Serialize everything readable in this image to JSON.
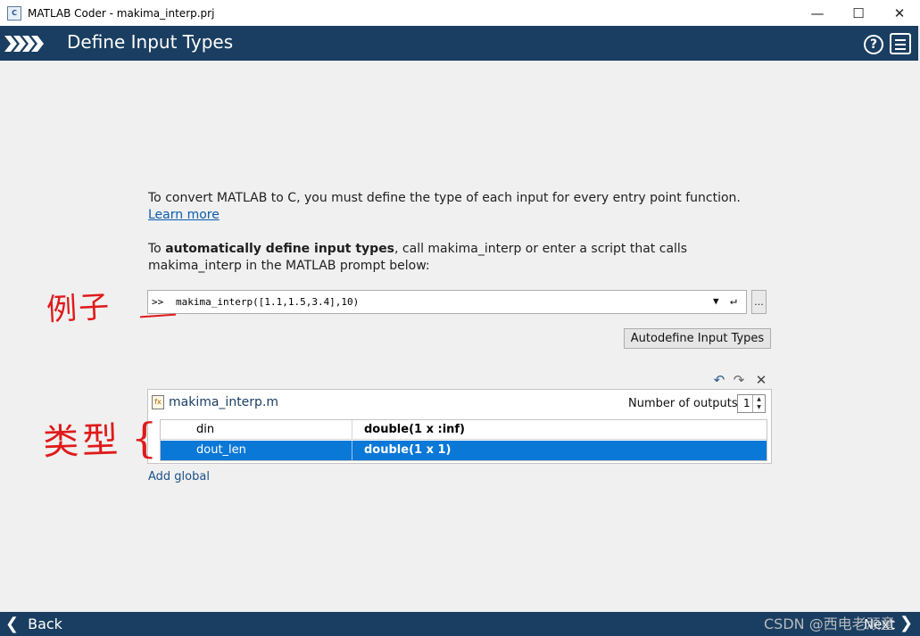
{
  "window": {
    "title": "MATLAB Coder - makima_interp.prj",
    "app_icon": "matlab-coder-icon",
    "controls": [
      "—",
      "☐",
      "✕"
    ]
  },
  "header": {
    "title": "Define Input Types"
  },
  "intro": {
    "text": "To convert MATLAB to C, you must define the type of each input for every entry point function.",
    "learn_link": "Learn more"
  },
  "auto": {
    "prefix": "To ",
    "bold": "automatically define input types",
    "suffix": ", call makima_interp or enter a script that calls makima_interp in the MATLAB prompt below:"
  },
  "command": {
    "prompt": ">>",
    "value": "makima_interp([1.1,1.5,3.4],10)",
    "dropdown": "▼",
    "enter": "↵",
    "browse_label": "..."
  },
  "autodefine_button": "Autodefine Input Types",
  "panel": {
    "file_name": "makima_interp.m",
    "outputs_label": "Number of outputs:",
    "outputs_value": "1",
    "rows": [
      {
        "name": "din",
        "type": "double(1 x :inf)",
        "selected": false
      },
      {
        "name": "dout_len",
        "type": "double(1 x 1)",
        "selected": true
      }
    ]
  },
  "add_global": "Add global",
  "annotations": {
    "example": "例子",
    "types": "类型",
    "brace": "{"
  },
  "footer": {
    "back": "Back",
    "next": "Next",
    "watermark": "CSDN @西电老顽童"
  },
  "colors": {
    "header_bg": "#1a3e61",
    "selected_row": "#0a78d7",
    "link": "#0c5cad",
    "annotation": "#e01a1a"
  }
}
